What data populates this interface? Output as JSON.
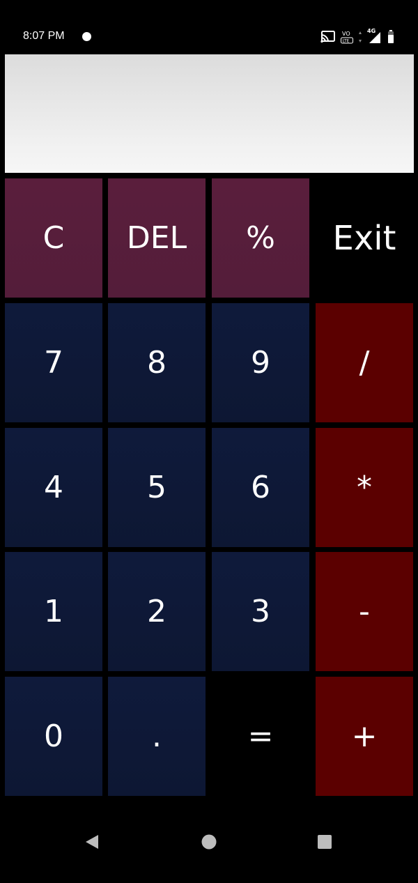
{
  "status_bar": {
    "time": "8:07 PM",
    "icons": [
      "notification-dot-icon",
      "cast-icon",
      "volte-icon",
      "data-arrows-icon",
      "signal-4g-icon",
      "battery-icon"
    ],
    "network_label": "4G"
  },
  "display": {
    "value": ""
  },
  "keypad": {
    "rows": [
      [
        {
          "label": "C",
          "type": "function",
          "color": "#5a1e3c"
        },
        {
          "label": "DEL",
          "type": "function",
          "color": "#5a1e3c"
        },
        {
          "label": "%",
          "type": "function",
          "color": "#5a1e3c"
        },
        {
          "label": "Exit",
          "type": "plain",
          "color": "#000000"
        }
      ],
      [
        {
          "label": "7",
          "type": "number",
          "color": "#0f1a3b"
        },
        {
          "label": "8",
          "type": "number",
          "color": "#0f1a3b"
        },
        {
          "label": "9",
          "type": "number",
          "color": "#0f1a3b"
        },
        {
          "label": "/",
          "type": "operator",
          "color": "#5b0000"
        }
      ],
      [
        {
          "label": "4",
          "type": "number",
          "color": "#0f1a3b"
        },
        {
          "label": "5",
          "type": "number",
          "color": "#0f1a3b"
        },
        {
          "label": "6",
          "type": "number",
          "color": "#0f1a3b"
        },
        {
          "label": "*",
          "type": "operator",
          "color": "#5b0000"
        }
      ],
      [
        {
          "label": "1",
          "type": "number",
          "color": "#0f1a3b"
        },
        {
          "label": "2",
          "type": "number",
          "color": "#0f1a3b"
        },
        {
          "label": "3",
          "type": "number",
          "color": "#0f1a3b"
        },
        {
          "label": "-",
          "type": "operator",
          "color": "#5b0000"
        }
      ],
      [
        {
          "label": "0",
          "type": "number",
          "color": "#0f1a3b"
        },
        {
          "label": ".",
          "type": "number",
          "color": "#0f1a3b"
        },
        {
          "label": "=",
          "type": "plain",
          "color": "#000000"
        },
        {
          "label": "+",
          "type": "operator",
          "color": "#5b0000"
        }
      ]
    ]
  },
  "nav_bar": {
    "icons": [
      "back-icon",
      "home-icon",
      "recents-icon"
    ]
  },
  "colors": {
    "background": "#000000",
    "display_bg": "#eeeeee",
    "function_key": "#5a1e3c",
    "number_key": "#0f1a3b",
    "operator_key": "#5b0000",
    "key_text": "#ffffff"
  }
}
